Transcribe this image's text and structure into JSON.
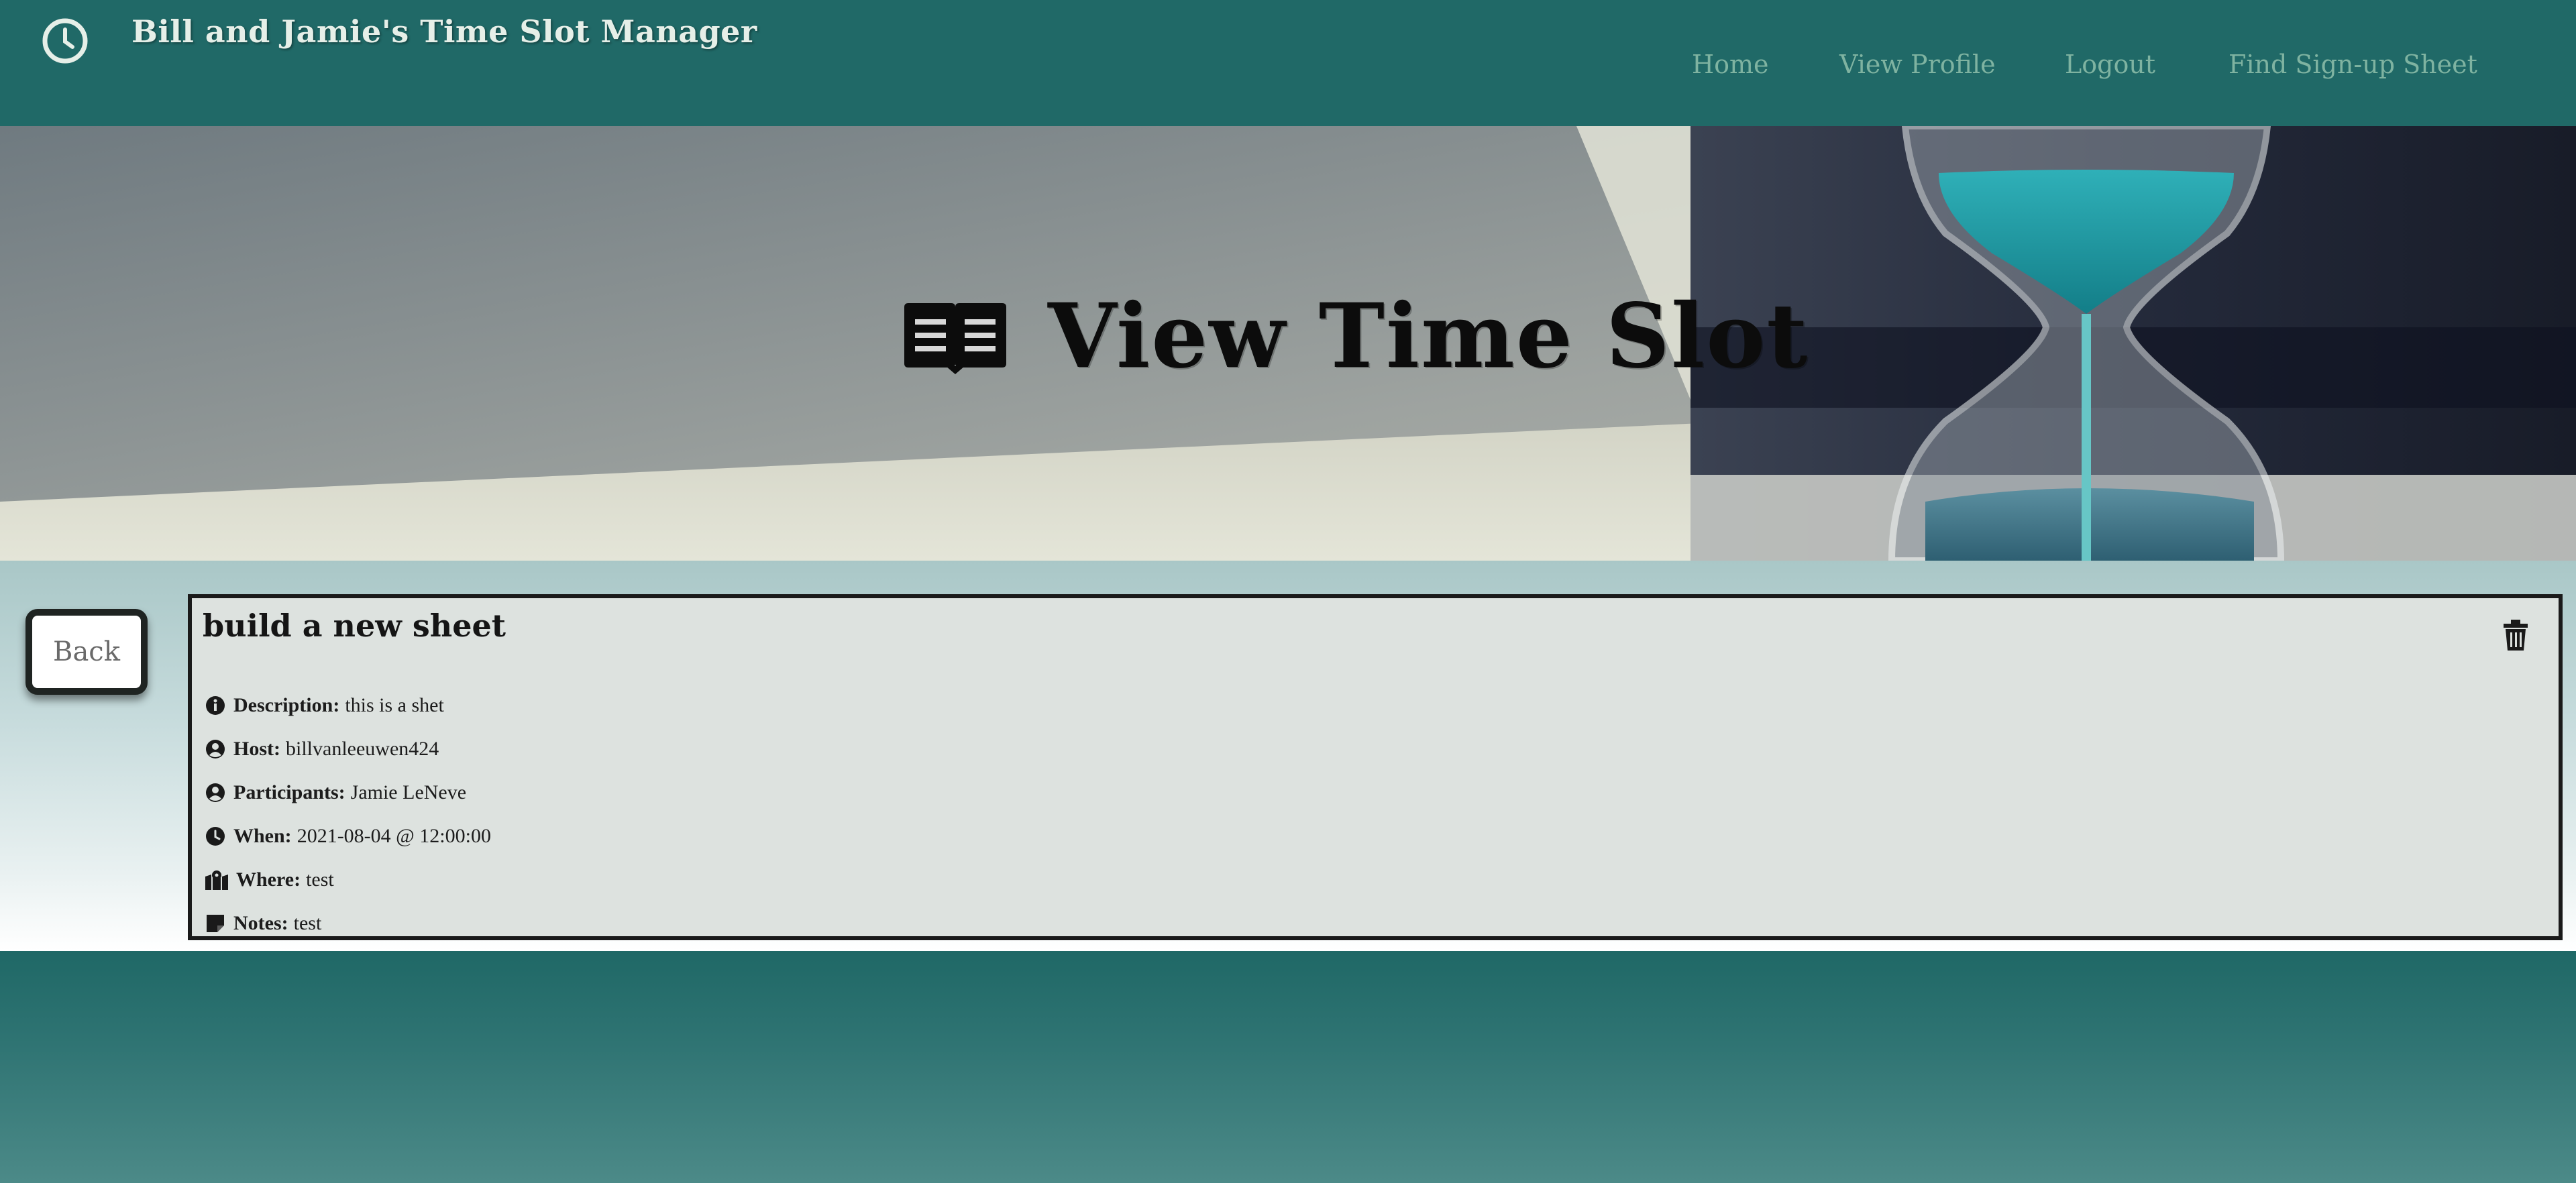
{
  "header": {
    "title": "Bill and Jamie's Time Slot Manager",
    "logo_icon": "clock-icon",
    "nav": {
      "home": "Home",
      "view_profile": "View Profile",
      "logout": "Logout",
      "find_sheet": "Find Sign-up Sheet"
    }
  },
  "hero": {
    "title": "View Time Slot",
    "icon": "book-open-icon"
  },
  "back_button": {
    "label": "Back"
  },
  "slot": {
    "title": "build a new sheet",
    "delete_icon": "trash-icon",
    "fields": {
      "description": {
        "label": "Description:",
        "value": "this is a shet",
        "icon": "info-circle-icon"
      },
      "host": {
        "label": "Host:",
        "value": "billvanleeuwen424",
        "icon": "user-circle-icon"
      },
      "participants": {
        "label": "Participants:",
        "value": "Jamie LeNeve",
        "icon": "user-circle-icon"
      },
      "when": {
        "label": "When:",
        "value": "2021-08-04 @ 12:00:00",
        "icon": "clock-icon"
      },
      "where": {
        "label": "Where:",
        "value": "test",
        "icon": "map-marked-icon"
      },
      "notes": {
        "label": "Notes:",
        "value": "test",
        "icon": "sticky-note-icon"
      }
    }
  },
  "colors": {
    "header_bg": "#206967",
    "nav_link": "#7fb3a1",
    "card_bg": "#dde2df",
    "footer_bg": "#2f7473"
  }
}
